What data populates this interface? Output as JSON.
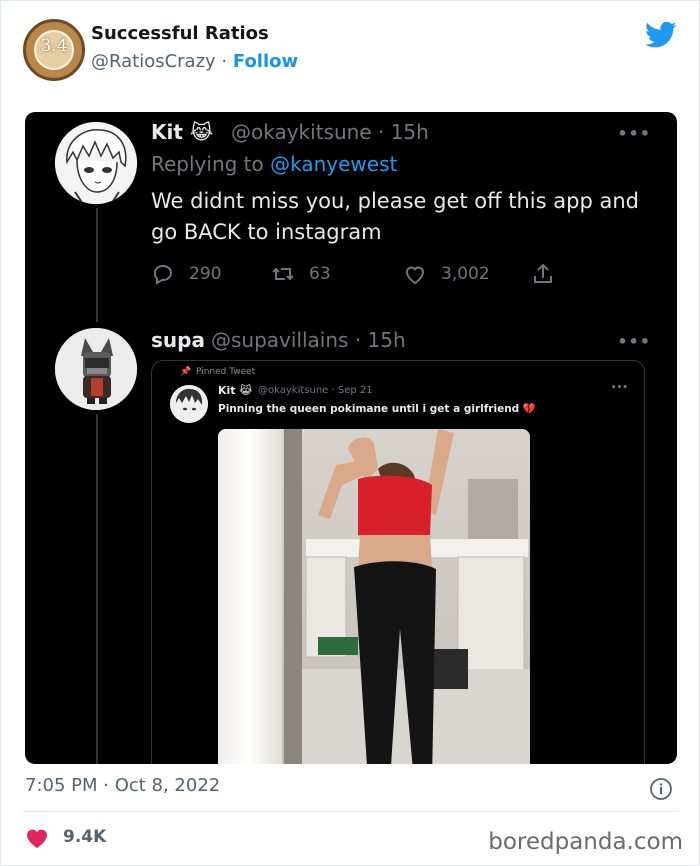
{
  "embed": {
    "account_name": "Successful Ratios",
    "account_handle": "@RatiosCrazy",
    "separator": " · ",
    "follow_label": "Follow",
    "avatar_text": "3.4",
    "timestamp": "7:05 PM · Oct 8, 2022",
    "likes": "9.4K",
    "accent_color": "#1b95e0",
    "heart_color": "#e0245e"
  },
  "screenshot": {
    "tweet1": {
      "name": "Kit",
      "emoji": "😹",
      "handle": "@okaykitsune",
      "time": "15h",
      "replying_prefix": "Replying to ",
      "replying_to": "@kanyewest",
      "body": "We didnt miss you, please get off this app and go BACK to instagram",
      "replies": "290",
      "retweets": "63",
      "likes": "3,002"
    },
    "tweet2": {
      "name": "supa",
      "handle": "@supavillains",
      "time": "15h"
    },
    "quoted": {
      "pinned_label": "Pinned Tweet",
      "name": "Kit",
      "emoji": "😹",
      "handle": "@okaykitsune",
      "time": "Sep 21",
      "body": "Pinning the queen pokimane until i get a girlfriend",
      "body_emoji": "💔"
    }
  },
  "watermark": "boredpanda.com"
}
